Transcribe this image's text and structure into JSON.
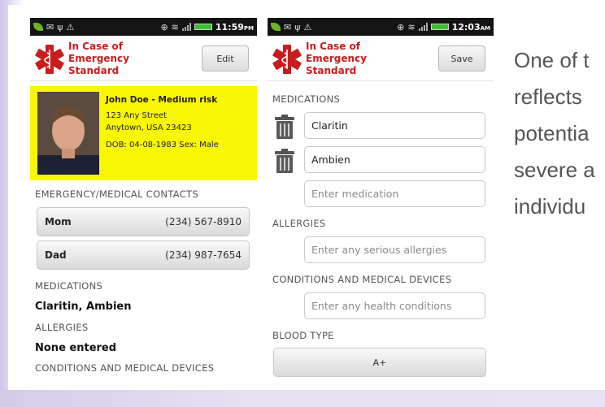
{
  "phone1": {
    "status": {
      "clock": "11:59",
      "clock_suffix": "PM"
    },
    "app": {
      "brand_line1": "In Case of",
      "brand_line2": "Emergency",
      "brand_line3": "Standard",
      "action_button": "Edit"
    },
    "profile": {
      "name_risk": "John Doe - Medium risk",
      "address1": "123 Any Street",
      "address2": "Anytown, USA 23423",
      "dob_sex": "DOB: 04-08-1983  Sex: Male"
    },
    "contacts_label": "EMERGENCY/MEDICAL CONTACTS",
    "contacts": [
      {
        "name": "Mom",
        "phone": "(234) 567-8910"
      },
      {
        "name": "Dad",
        "phone": "(234) 987-7654"
      }
    ],
    "medications_label": "MEDICATIONS",
    "medications_value": "Claritin, Ambien",
    "allergies_label": "ALLERGIES",
    "allergies_value": "None entered",
    "conditions_label": "CONDITIONS AND MEDICAL DEVICES"
  },
  "phone2": {
    "status": {
      "clock": "12:03",
      "clock_suffix": "AM"
    },
    "app": {
      "brand_line1": "In Case of",
      "brand_line2": "Emergency",
      "brand_line3": "Standard",
      "action_button": "Save"
    },
    "medications_label": "MEDICATIONS",
    "medications": [
      "Claritin",
      "Ambien"
    ],
    "medication_placeholder": "Enter medication",
    "allergies_label": "ALLERGIES",
    "allergies_placeholder": "Enter any serious allergies",
    "conditions_label": "CONDITIONS AND MEDICAL DEVICES",
    "conditions_placeholder": "Enter any health conditions",
    "blood_type_label": "BLOOD TYPE",
    "blood_type_value": "A+"
  },
  "side_text": [
    "One of t",
    "reflects",
    "potentia",
    "severe a",
    "individu"
  ],
  "colors": {
    "brand_red": "#c81d1d",
    "profile_yellow": "#f8f600",
    "status_bar": "#141414"
  }
}
